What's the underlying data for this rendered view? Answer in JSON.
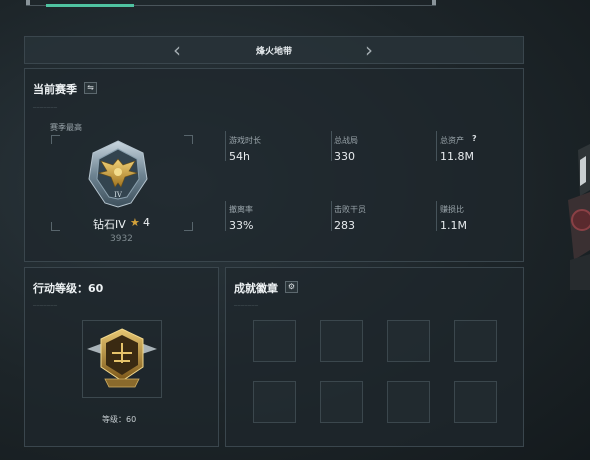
{
  "nav": {
    "title": "烽火地带",
    "prev_icon": "chevron-left-icon",
    "next_icon": "chevron-right-icon"
  },
  "season": {
    "title": "当前赛季",
    "switch_icon": "swap-icon",
    "highest_label": "赛季最高",
    "rank_name": "钻石IV",
    "star_count": "4",
    "rank_score": "3932",
    "stats": [
      {
        "label": "游戏时长",
        "value": "54h"
      },
      {
        "label": "总战局",
        "value": "330"
      },
      {
        "label": "总资产",
        "value": "11.8M",
        "help": "?"
      },
      {
        "label": "撤离率",
        "value": "33%"
      },
      {
        "label": "击败干员",
        "value": "283"
      },
      {
        "label": "赚损比",
        "value": "1.1M"
      }
    ]
  },
  "action_level": {
    "title": "行动等级：60",
    "level_label": "等级：60"
  },
  "achievements": {
    "title": "成就徽章",
    "settings_icon": "gear-icon"
  },
  "colors": {
    "accent": "#4fc3a1",
    "gold": "#d4a23a",
    "panel": "#1e272c"
  }
}
